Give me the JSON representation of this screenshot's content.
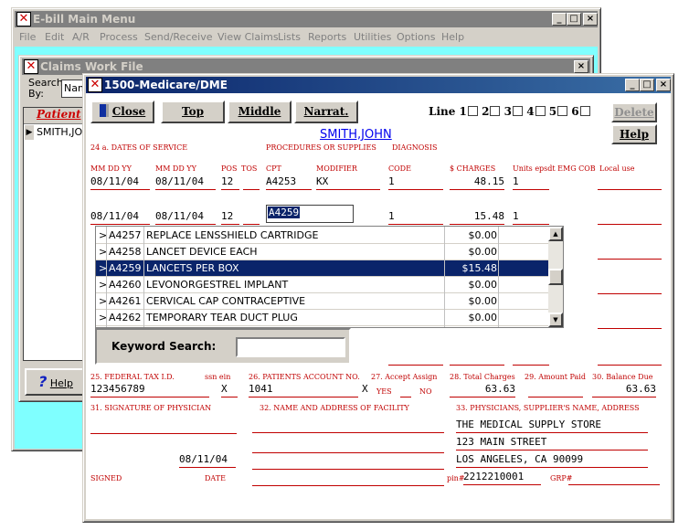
{
  "main_window": {
    "title": "E-bill Main Menu",
    "menu": [
      "File",
      "Edit",
      "A/R",
      "Process",
      "Send/Receive",
      "View Claims",
      "Lists",
      "Reports",
      "Utilities",
      "Options",
      "Help"
    ]
  },
  "claims_window": {
    "title": "Claims Work File",
    "search_label": "Search\nBy:",
    "search_value": "Nam",
    "column_header": "Patient",
    "row_value": "SMITH,JOI",
    "help_label": "Help"
  },
  "form": {
    "title": "1500-Medicare/DME",
    "buttons": {
      "close": "Close",
      "top": "Top",
      "middle": "Middle",
      "narrat": "Narrat.",
      "delete": "Delete",
      "help": "Help"
    },
    "line_label": "Line",
    "lines": [
      "1",
      "2",
      "3",
      "4",
      "5",
      "6"
    ],
    "patient_name": "SMITH,JOHN",
    "section24": {
      "title": "24 a. DATES OF SERVICE",
      "proc_title": "PROCEDURES OR SUPPLIES",
      "diag_title": "DIAGNOSIS",
      "h_from": "MM DD YY",
      "h_to": "MM DD YY",
      "h_pos": "POS",
      "h_tos": "TOS",
      "h_cpt": "CPT",
      "h_mod": "MODIFIER",
      "h_code": "CODE",
      "h_charges": "$ CHARGES",
      "h_units": "Units epsdt EMG COB",
      "h_local": "Local use",
      "line1": {
        "from": "08/11/04",
        "to": "08/11/04",
        "pos": "12",
        "cpt": "A4253",
        "mod": "KX",
        "code": "1",
        "charges": "48.15",
        "units": "1"
      },
      "line2": {
        "from": "08/11/04",
        "to": "08/11/04",
        "pos": "12",
        "cpt": "A4259",
        "code": "1",
        "charges": "15.48",
        "units": "1"
      }
    },
    "lookup": {
      "rows": [
        {
          "mark": ">",
          "code": "A4257",
          "desc": "REPLACE LENSSHIELD CARTRIDGE",
          "price": "$0.00"
        },
        {
          "mark": ">",
          "code": "A4258",
          "desc": "LANCET DEVICE EACH",
          "price": "$0.00"
        },
        {
          "mark": ">",
          "code": "A4259",
          "desc": "LANCETS PER BOX",
          "price": "$15.48"
        },
        {
          "mark": ">",
          "code": "A4260",
          "desc": "LEVONORGESTREL IMPLANT",
          "price": "$0.00"
        },
        {
          "mark": ">",
          "code": "A4261",
          "desc": "CERVICAL CAP CONTRACEPTIVE",
          "price": "$0.00"
        },
        {
          "mark": ">",
          "code": "A4262",
          "desc": "TEMPORARY TEAR DUCT PLUG",
          "price": "$0.00"
        }
      ],
      "keyword_label": "Keyword Search:"
    },
    "section25": {
      "tax_label": "25. FEDERAL TAX I.D.",
      "ssn_label": "ssn ein",
      "tax_value": "123456789",
      "tax_x": "X",
      "acct_label": "26. PATIENTS ACCOUNT NO.",
      "acct_value": "1041",
      "assign_label": "27. Accept Assign",
      "assign_x": "X",
      "yes": "YES",
      "no": "NO",
      "total_label": "28. Total Charges",
      "total_value": "63.63",
      "paid_label": "29. Amount Paid",
      "balance_label": "30. Balance Due",
      "balance_value": "63.63"
    },
    "section31": {
      "sig_label": "31. SIGNATURE OF PHYSICIAN",
      "date_value": "08/11/04",
      "signed": "SIGNED",
      "date": "DATE"
    },
    "section32": {
      "label": "32. NAME AND ADDRESS OF FACILITY"
    },
    "section33": {
      "label": "33. PHYSICIANS, SUPPLIER'S NAME, ADDRESS",
      "name": "THE MEDICAL SUPPLY STORE",
      "addr1": "123 MAIN STREET",
      "addr2": "LOS ANGELES, CA 90099",
      "pin_label": "pin#",
      "pin_value": "2212210001",
      "grp_label": "GRP#"
    }
  }
}
